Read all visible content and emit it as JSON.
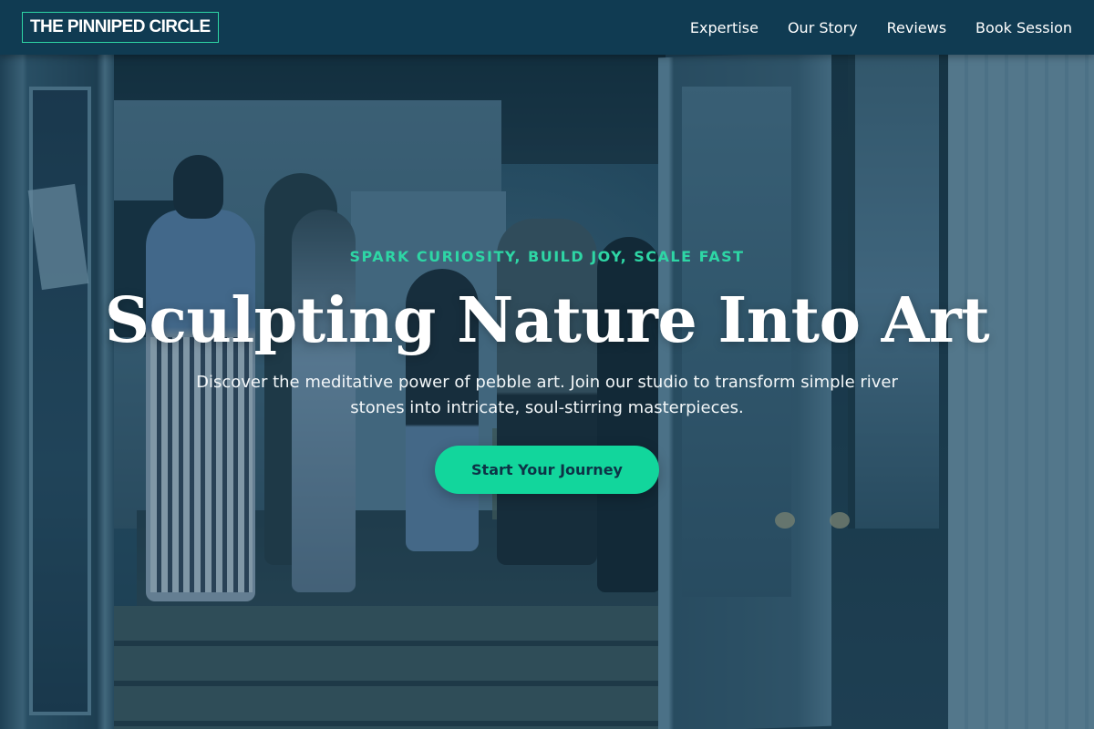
{
  "nav": {
    "logo": "THE PINNIPED CIRCLE",
    "links": [
      "Expertise",
      "Our Story",
      "Reviews",
      "Book Session"
    ]
  },
  "hero": {
    "eyebrow": "SPARK CURIOSITY, BUILD JOY, SCALE FAST",
    "headline": "Sculpting Nature Into Art",
    "subhead": "Discover the meditative power of pebble art. Join our studio to transform simple river stones into intricate, soul-stirring masterpieces.",
    "cta_label": "Start Your Journey"
  },
  "colors": {
    "nav_bg": "#103b52",
    "accent": "#12d69c",
    "overlay": "#103a52"
  }
}
